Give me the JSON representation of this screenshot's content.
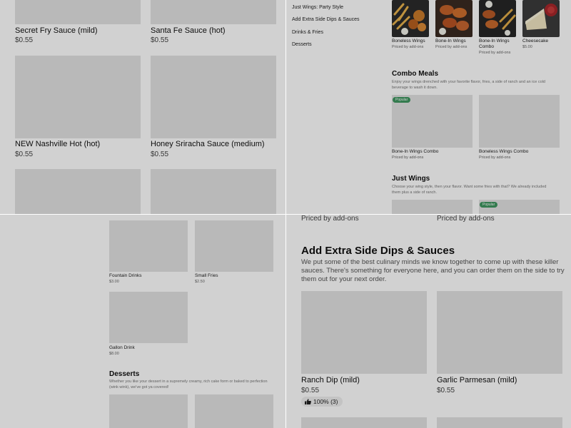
{
  "q1": {
    "items": [
      {
        "name": "Secret Fry Sauce (mild)",
        "price": "$0.55"
      },
      {
        "name": "Santa Fe Sauce (hot)",
        "price": "$0.55"
      },
      {
        "name": "NEW Nashville Hot (hot)",
        "price": "$0.55"
      },
      {
        "name": "Honey Sriracha Sauce (medium)",
        "price": "$0.55"
      }
    ]
  },
  "q2": {
    "sidebar": [
      "Just Wings: Party Style",
      "Add Extra Side Dips & Sauces",
      "Drinks & Fries",
      "Desserts"
    ],
    "featured": [
      {
        "name": "Boneless Wings",
        "price": "Priced by add-ons"
      },
      {
        "name": "Bone-In Wings",
        "price": "Priced by add-ons"
      },
      {
        "name": "Bone-In Wings Combo",
        "price": "Priced by add-ons"
      },
      {
        "name": "Cheesecake",
        "price": "$5.00"
      }
    ],
    "combo": {
      "title": "Combo Meals",
      "desc": "Enjoy your wings drenched with your favorite flavor, fries, a side of ranch and an ice cold beverage to wash it down.",
      "badge": "Popular",
      "items": [
        {
          "name": "Bone-In Wings Combo",
          "price": "Priced by add-ons"
        },
        {
          "name": "Boneless Wings Combo",
          "price": "Priced by add-ons"
        }
      ]
    },
    "just_wings": {
      "title": "Just Wings",
      "desc": "Choose your wing style, then your flavor. Want some fries with that? We already included them plus a side of ranch.",
      "badge": "Popular"
    }
  },
  "q3": {
    "items": [
      {
        "name": "Fountain Drinks",
        "price": "$3.00"
      },
      {
        "name": "Small Fries",
        "price": "$2.50"
      },
      {
        "name": "Gallon Drink",
        "price": "$8.00"
      }
    ],
    "desserts": {
      "title": "Desserts",
      "desc": "Whether you like your dessert in a supremely creamy, rich cake form or baked to perfection (wink wink), we've got ya covered!"
    }
  },
  "q4": {
    "top_prices": [
      "Priced by add-ons",
      "Priced by add-ons"
    ],
    "section": {
      "title": "Add Extra Side Dips & Sauces",
      "desc": "We put some of the best culinary minds we know together to come up with these killer sauces. There's something for everyone here, and you can order them on the side to try them out for your next order."
    },
    "items": [
      {
        "name": "Ranch Dip (mild)",
        "price": "$0.55",
        "rating": "100% (3)"
      },
      {
        "name": "Garlic Parmesan (mild)",
        "price": "$0.55"
      }
    ]
  },
  "colors": {
    "accent_green": "#3f9660",
    "placeholder": "#e2e2e2"
  }
}
